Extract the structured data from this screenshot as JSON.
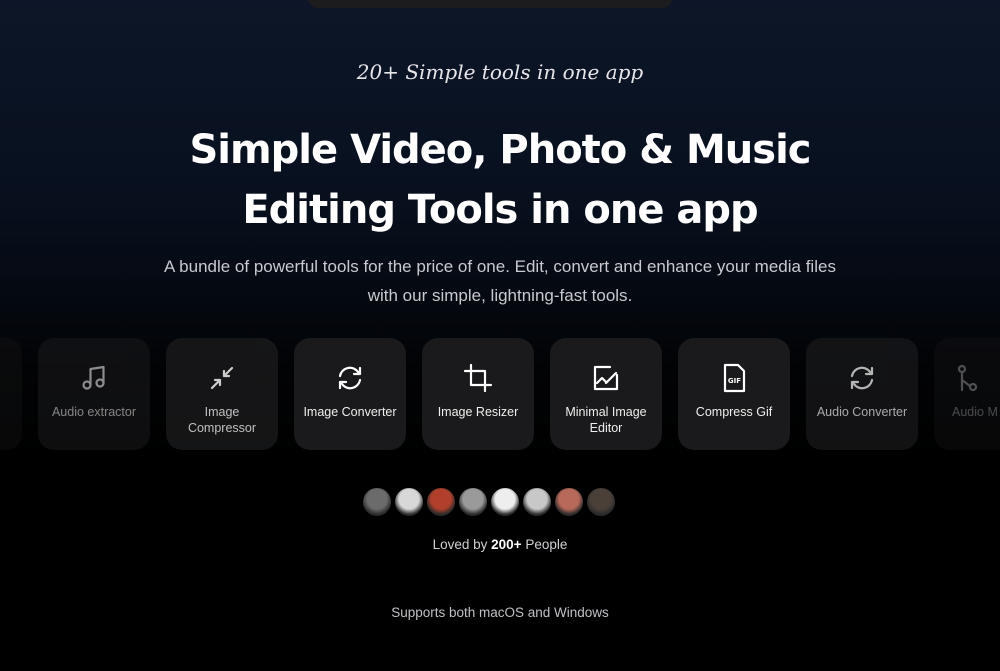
{
  "hero": {
    "tagline": "20+ Simple tools in one app",
    "title_line1": "Simple Video, Photo & Music",
    "title_line2": "Editing Tools in one app",
    "subtitle": "A bundle of powerful tools for the price of one. Edit, convert and enhance your media files with our simple, lightning-fast tools."
  },
  "tools": [
    {
      "label": "Audio extractor",
      "icon": "music-icon"
    },
    {
      "label": "Image Compressor",
      "icon": "compress-icon"
    },
    {
      "label": "Image Converter",
      "icon": "refresh-icon"
    },
    {
      "label": "Image Resizer",
      "icon": "crop-icon"
    },
    {
      "label": "Minimal Image Editor",
      "icon": "image-edit-icon"
    },
    {
      "label": "Compress Gif",
      "icon": "gif-file-icon"
    },
    {
      "label": "Audio Converter",
      "icon": "refresh-icon"
    },
    {
      "label": "Audio M",
      "icon": "audio-merge-icon"
    }
  ],
  "gif_text": "GIF",
  "social": {
    "prefix": "Loved by ",
    "count": "200+",
    "suffix": " People",
    "avatar_colors": [
      "#6b6b6b",
      "#d8d8d8",
      "#b0402c",
      "#9a9a9a",
      "#eeeeee",
      "#c8c8c8",
      "#b86a5a",
      "#4a4038"
    ]
  },
  "footer": {
    "supports": "Supports both macOS and Windows"
  }
}
